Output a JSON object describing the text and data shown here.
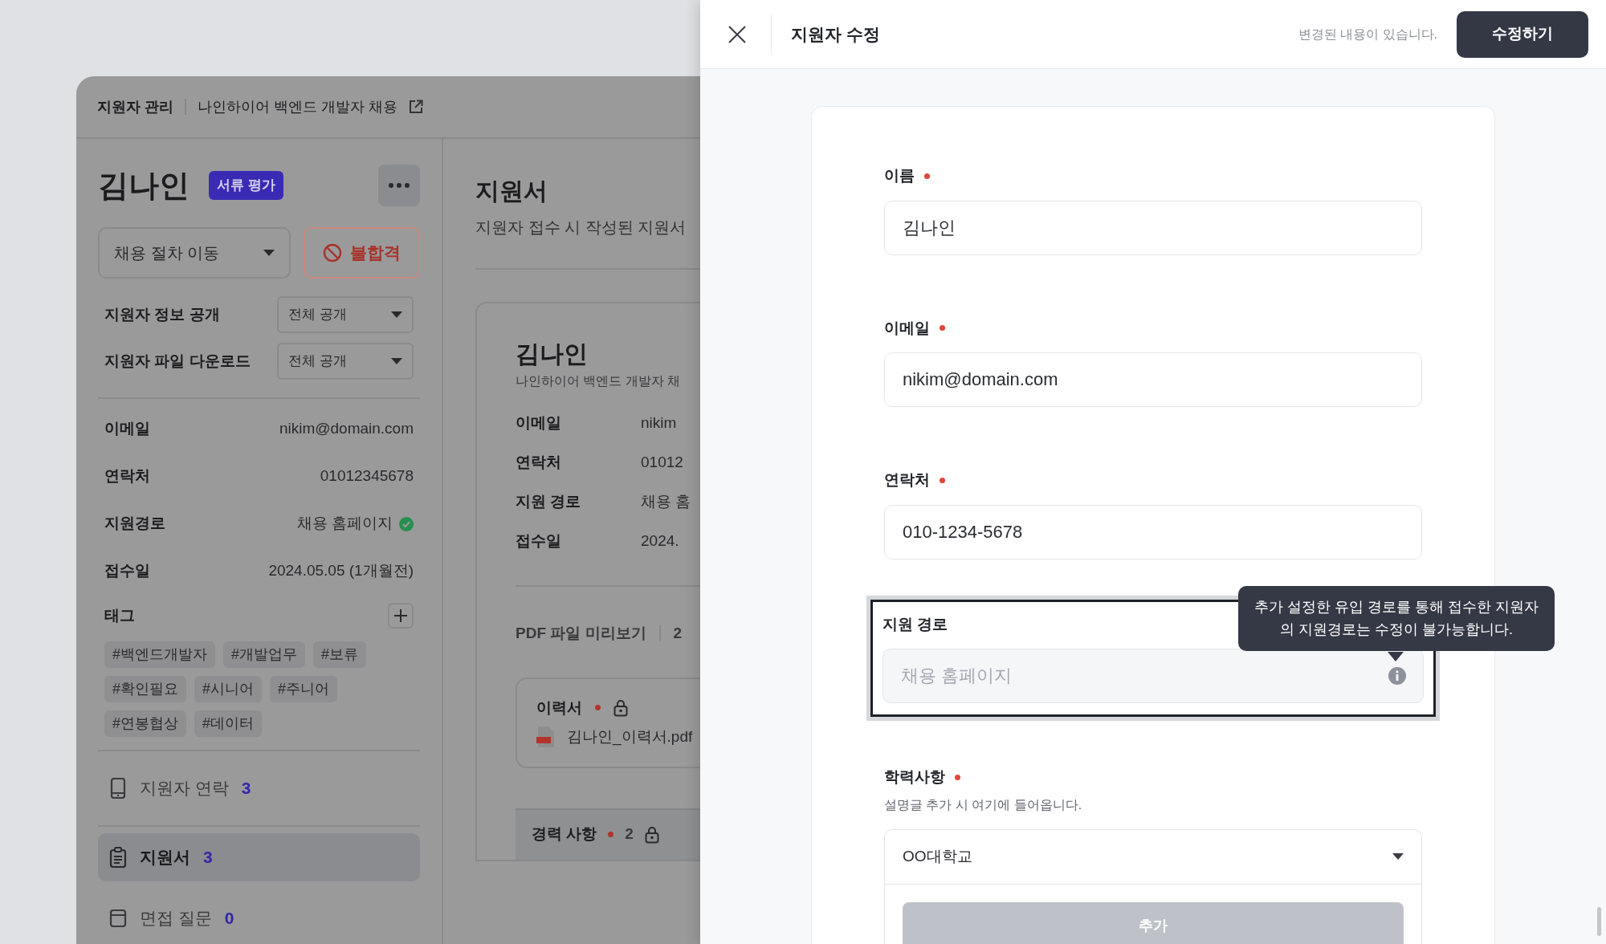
{
  "breadcrumb": {
    "section": "지원자 관리",
    "posting": "나인하이어 백엔드 개발자 채용"
  },
  "applicant": {
    "name": "김나인",
    "stage_badge": "서류 평가"
  },
  "actions": {
    "move_stage": "채용 절차 이동",
    "reject": "불합격"
  },
  "settings": [
    {
      "label": "지원자 정보 공개",
      "value": "전체 공개"
    },
    {
      "label": "지원자 파일 다운로드",
      "value": "전체 공개"
    }
  ],
  "info": [
    {
      "label": "이메일",
      "value": "nikim@domain.com",
      "verified": false
    },
    {
      "label": "연락처",
      "value": "01012345678",
      "verified": false
    },
    {
      "label": "지원경로",
      "value": "채용 홈페이지",
      "verified": true
    },
    {
      "label": "접수일",
      "value": "2024.05.05 (1개월전)",
      "verified": false
    }
  ],
  "tags": {
    "label": "태그",
    "items": [
      "#백엔드개발자",
      "#개발업무",
      "#보류",
      "#확인필요",
      "#시니어",
      "#주니어",
      "#연봉협상",
      "#데이터"
    ]
  },
  "sidebar_nav": [
    {
      "kind": "phone",
      "label": "지원자 연락",
      "count": "3",
      "selected": false
    },
    {
      "kind": "clipboard",
      "label": "지원서",
      "count": "3",
      "selected": true
    },
    {
      "kind": "tray",
      "label": "면접 질문",
      "count": "0",
      "selected": false
    }
  ],
  "content": {
    "title": "지원서",
    "subtitle": "지원자 접수 시 작성된 지원서",
    "preview": {
      "name": "김나인",
      "posting": "나인하이어 백엔드 개발자 채",
      "rows": [
        {
          "label": "이메일",
          "value": "nikim"
        },
        {
          "label": "연락처",
          "value": "01012"
        },
        {
          "label": "지원 경로",
          "value": "채용 홈"
        },
        {
          "label": "접수일",
          "value": "2024."
        }
      ]
    },
    "pdf": {
      "label": "PDF 파일 미리보기",
      "count": "2"
    },
    "files": [
      {
        "title": "이력서",
        "required": true,
        "locked": true,
        "file": "김나인_이력서.pdf"
      }
    ],
    "career": {
      "title": "경력 사항",
      "required": true,
      "count": "2",
      "locked": true
    }
  },
  "drawer": {
    "title": "지원자 수정",
    "status": "변경된 내용이 있습니다.",
    "submit": "수정하기",
    "fields": [
      {
        "kind": "text",
        "label": "이름",
        "required": true,
        "value": "김나인"
      },
      {
        "kind": "text",
        "label": "이메일",
        "required": true,
        "value": "nikim@domain.com"
      },
      {
        "kind": "text",
        "label": "연락처",
        "required": true,
        "value": "010-1234-5678"
      },
      {
        "kind": "locked",
        "label": "지원 경로",
        "required": false,
        "focused": true,
        "placeholder": "채용 홈페이지",
        "tooltip": "추가 설정한 유입 경로를 통해 접수한 지원자의 지원경로는 수정이 불가능합니다."
      },
      {
        "kind": "select",
        "label": "학력사항",
        "required": true,
        "description": "설명글 추가 시 여기에 들어옵니다.",
        "value": "OO대학교",
        "add_button": "추가"
      }
    ]
  }
}
